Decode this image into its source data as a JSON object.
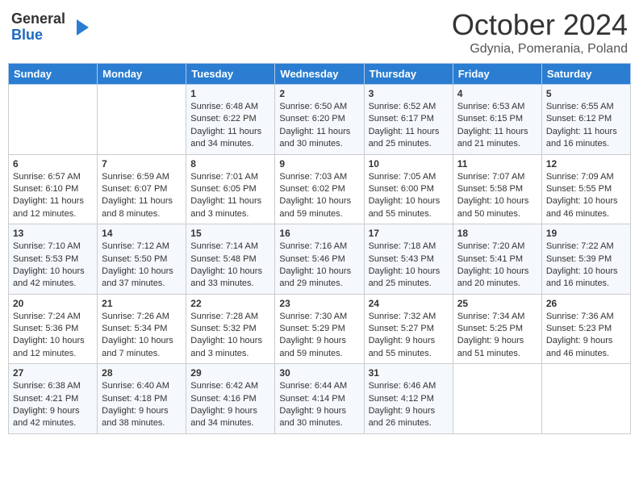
{
  "header": {
    "logo_general": "General",
    "logo_blue": "Blue",
    "month": "October 2024",
    "location": "Gdynia, Pomerania, Poland"
  },
  "days_of_week": [
    "Sunday",
    "Monday",
    "Tuesday",
    "Wednesday",
    "Thursday",
    "Friday",
    "Saturday"
  ],
  "weeks": [
    [
      {
        "day": "",
        "info": ""
      },
      {
        "day": "",
        "info": ""
      },
      {
        "day": "1",
        "info": "Sunrise: 6:48 AM\nSunset: 6:22 PM\nDaylight: 11 hours\nand 34 minutes."
      },
      {
        "day": "2",
        "info": "Sunrise: 6:50 AM\nSunset: 6:20 PM\nDaylight: 11 hours\nand 30 minutes."
      },
      {
        "day": "3",
        "info": "Sunrise: 6:52 AM\nSunset: 6:17 PM\nDaylight: 11 hours\nand 25 minutes."
      },
      {
        "day": "4",
        "info": "Sunrise: 6:53 AM\nSunset: 6:15 PM\nDaylight: 11 hours\nand 21 minutes."
      },
      {
        "day": "5",
        "info": "Sunrise: 6:55 AM\nSunset: 6:12 PM\nDaylight: 11 hours\nand 16 minutes."
      }
    ],
    [
      {
        "day": "6",
        "info": "Sunrise: 6:57 AM\nSunset: 6:10 PM\nDaylight: 11 hours\nand 12 minutes."
      },
      {
        "day": "7",
        "info": "Sunrise: 6:59 AM\nSunset: 6:07 PM\nDaylight: 11 hours\nand 8 minutes."
      },
      {
        "day": "8",
        "info": "Sunrise: 7:01 AM\nSunset: 6:05 PM\nDaylight: 11 hours\nand 3 minutes."
      },
      {
        "day": "9",
        "info": "Sunrise: 7:03 AM\nSunset: 6:02 PM\nDaylight: 10 hours\nand 59 minutes."
      },
      {
        "day": "10",
        "info": "Sunrise: 7:05 AM\nSunset: 6:00 PM\nDaylight: 10 hours\nand 55 minutes."
      },
      {
        "day": "11",
        "info": "Sunrise: 7:07 AM\nSunset: 5:58 PM\nDaylight: 10 hours\nand 50 minutes."
      },
      {
        "day": "12",
        "info": "Sunrise: 7:09 AM\nSunset: 5:55 PM\nDaylight: 10 hours\nand 46 minutes."
      }
    ],
    [
      {
        "day": "13",
        "info": "Sunrise: 7:10 AM\nSunset: 5:53 PM\nDaylight: 10 hours\nand 42 minutes."
      },
      {
        "day": "14",
        "info": "Sunrise: 7:12 AM\nSunset: 5:50 PM\nDaylight: 10 hours\nand 37 minutes."
      },
      {
        "day": "15",
        "info": "Sunrise: 7:14 AM\nSunset: 5:48 PM\nDaylight: 10 hours\nand 33 minutes."
      },
      {
        "day": "16",
        "info": "Sunrise: 7:16 AM\nSunset: 5:46 PM\nDaylight: 10 hours\nand 29 minutes."
      },
      {
        "day": "17",
        "info": "Sunrise: 7:18 AM\nSunset: 5:43 PM\nDaylight: 10 hours\nand 25 minutes."
      },
      {
        "day": "18",
        "info": "Sunrise: 7:20 AM\nSunset: 5:41 PM\nDaylight: 10 hours\nand 20 minutes."
      },
      {
        "day": "19",
        "info": "Sunrise: 7:22 AM\nSunset: 5:39 PM\nDaylight: 10 hours\nand 16 minutes."
      }
    ],
    [
      {
        "day": "20",
        "info": "Sunrise: 7:24 AM\nSunset: 5:36 PM\nDaylight: 10 hours\nand 12 minutes."
      },
      {
        "day": "21",
        "info": "Sunrise: 7:26 AM\nSunset: 5:34 PM\nDaylight: 10 hours\nand 7 minutes."
      },
      {
        "day": "22",
        "info": "Sunrise: 7:28 AM\nSunset: 5:32 PM\nDaylight: 10 hours\nand 3 minutes."
      },
      {
        "day": "23",
        "info": "Sunrise: 7:30 AM\nSunset: 5:29 PM\nDaylight: 9 hours\nand 59 minutes."
      },
      {
        "day": "24",
        "info": "Sunrise: 7:32 AM\nSunset: 5:27 PM\nDaylight: 9 hours\nand 55 minutes."
      },
      {
        "day": "25",
        "info": "Sunrise: 7:34 AM\nSunset: 5:25 PM\nDaylight: 9 hours\nand 51 minutes."
      },
      {
        "day": "26",
        "info": "Sunrise: 7:36 AM\nSunset: 5:23 PM\nDaylight: 9 hours\nand 46 minutes."
      }
    ],
    [
      {
        "day": "27",
        "info": "Sunrise: 6:38 AM\nSunset: 4:21 PM\nDaylight: 9 hours\nand 42 minutes."
      },
      {
        "day": "28",
        "info": "Sunrise: 6:40 AM\nSunset: 4:18 PM\nDaylight: 9 hours\nand 38 minutes."
      },
      {
        "day": "29",
        "info": "Sunrise: 6:42 AM\nSunset: 4:16 PM\nDaylight: 9 hours\nand 34 minutes."
      },
      {
        "day": "30",
        "info": "Sunrise: 6:44 AM\nSunset: 4:14 PM\nDaylight: 9 hours\nand 30 minutes."
      },
      {
        "day": "31",
        "info": "Sunrise: 6:46 AM\nSunset: 4:12 PM\nDaylight: 9 hours\nand 26 minutes."
      },
      {
        "day": "",
        "info": ""
      },
      {
        "day": "",
        "info": ""
      }
    ]
  ]
}
